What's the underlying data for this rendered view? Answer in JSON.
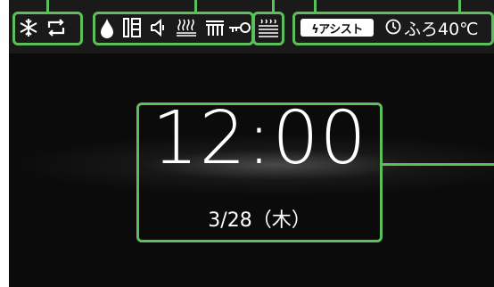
{
  "status_bar": {
    "icons": {
      "left": [
        "snowflake-icon",
        "repeat-icon"
      ],
      "middle": [
        "water-drop-icon",
        "thermometer-icon",
        "speaker-icon",
        "floor-heater-icon",
        "shower-heater-icon",
        "key-icon"
      ],
      "right": [
        "bathroom-heater-icon"
      ]
    },
    "assist_label": "ϟアシスト",
    "timer_text": "ふろ40℃"
  },
  "clock": {
    "time": "12:00",
    "date": "3/28（木）"
  },
  "colors": {
    "callout": "#5cc05a",
    "screen_bg": "#0b0b0b",
    "foreground": "#ffffff"
  }
}
